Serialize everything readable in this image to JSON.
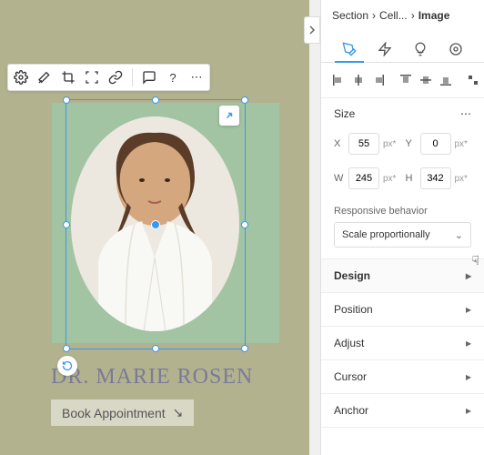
{
  "breadcrumb": {
    "section": "Section",
    "cell": "Cell...",
    "current": "Image"
  },
  "toolbar_icons": [
    "settings",
    "magic",
    "crop",
    "focus",
    "link",
    "sep",
    "comment",
    "help",
    "more"
  ],
  "size": {
    "label": "Size",
    "x_label": "X",
    "x_value": "55",
    "x_unit": "px*",
    "y_label": "Y",
    "y_value": "0",
    "y_unit": "px*",
    "w_label": "W",
    "w_value": "245",
    "w_unit": "px*",
    "h_label": "H",
    "h_value": "342",
    "h_unit": "px*"
  },
  "responsive": {
    "label": "Responsive behavior",
    "value": "Scale proportionally"
  },
  "accordion": {
    "design": "Design",
    "position": "Position",
    "adjust": "Adjust",
    "cursor": "Cursor",
    "anchor": "Anchor"
  },
  "canvas": {
    "doctor_name": "DR. MARIE ROSEN",
    "book_label": "Book Appointment",
    "book_arrow": "↘"
  }
}
